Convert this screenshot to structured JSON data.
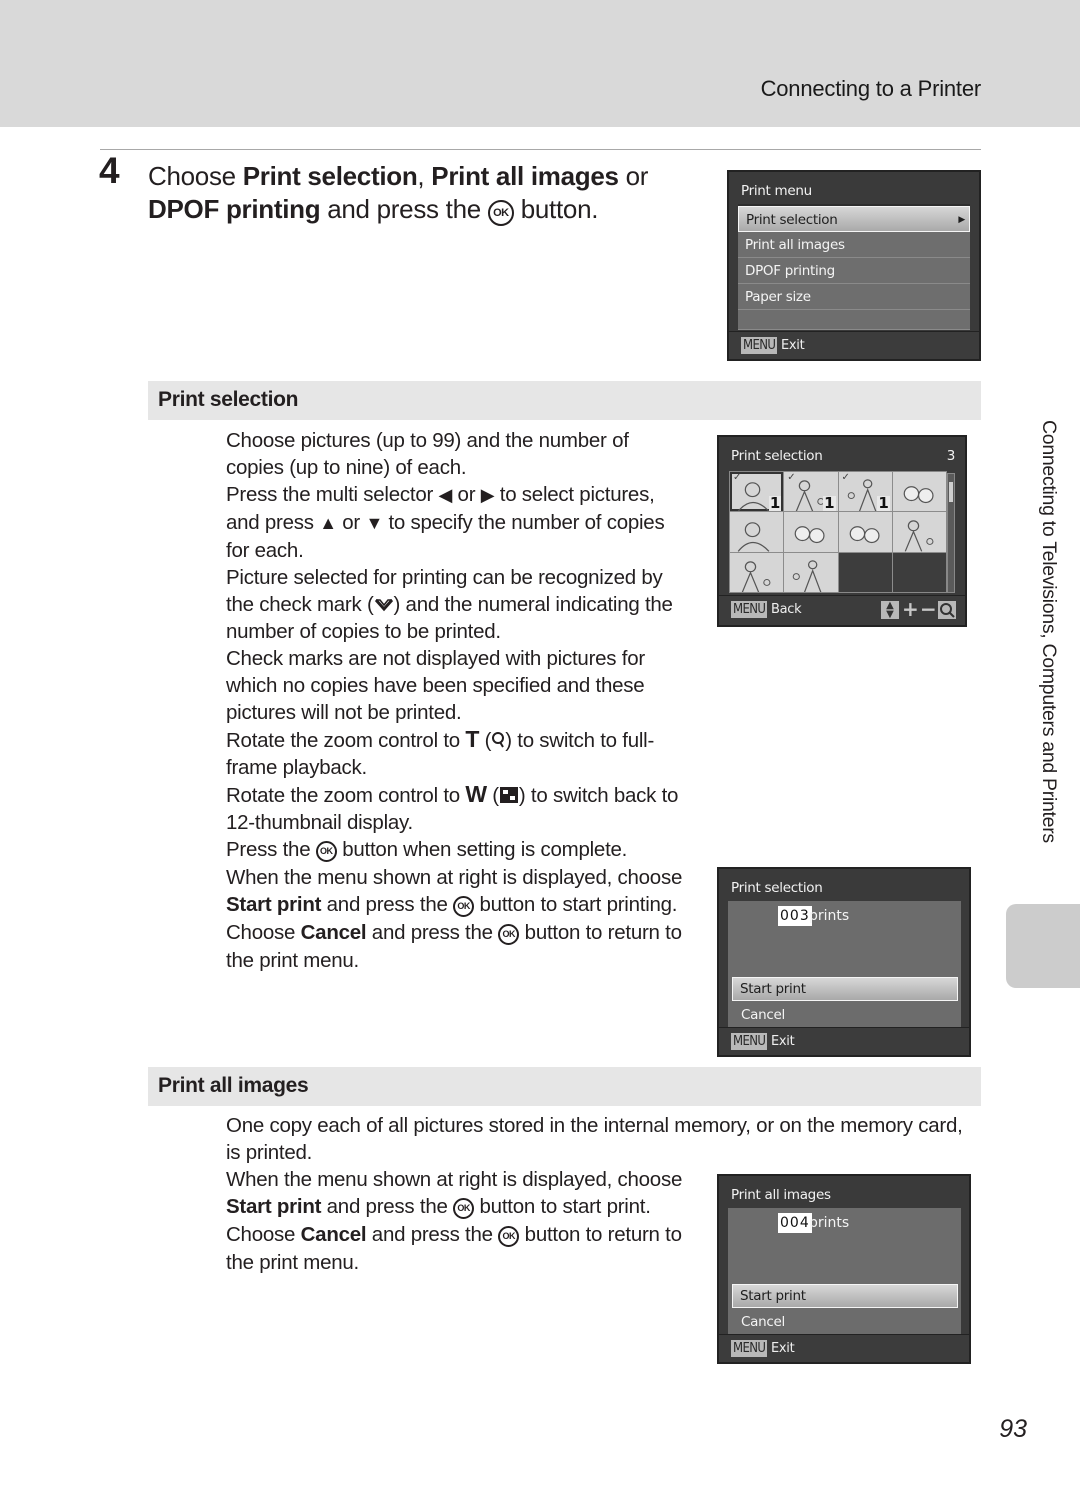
{
  "header": {
    "section_title": "Connecting to a Printer"
  },
  "step": {
    "number": "4",
    "text_parts": {
      "choose": "Choose ",
      "opt1": "Print selection",
      "sep1": ", ",
      "opt2": "Print all images",
      "sep2": " or",
      "opt3": "DPOF printing",
      "tail": " and press the ",
      "ok": "OK",
      "end": " button."
    }
  },
  "print_menu_screen": {
    "title": "Print menu",
    "items": [
      {
        "label": "Print selection",
        "selected": true
      },
      {
        "label": "Print all images",
        "selected": false
      },
      {
        "label": "DPOF printing",
        "selected": false
      },
      {
        "label": "Paper size",
        "selected": false
      }
    ],
    "footer_badge": "MENU",
    "footer_label": "Exit"
  },
  "print_selection": {
    "heading": "Print selection",
    "para1": "Choose pictures (up to 99) and the number of copies (up to nine) of each.",
    "para2_a": "Press the multi selector ",
    "left_arrow": "◀",
    "para2_or1": " or ",
    "right_arrow": "▶",
    "para2_b": " to select pictures, and press ",
    "up_arrow": "▲",
    "para2_or2": " or ",
    "down_arrow": "▼",
    "para2_c": " to specify the number of copies for each.",
    "para3_a": "Picture selected for printing can be recognized by the check mark (",
    "para3_b": ") and the numeral indicating the number of copies to be printed.",
    "para4": "Check marks are not displayed with pictures for which no copies have been specified and these pictures will not be printed.",
    "para5_a": "Rotate the zoom control to ",
    "para5_t": "T",
    "para5_b": " (",
    "para5_c": ") to switch to full-frame playback.",
    "para6_a": "Rotate the zoom control to ",
    "para6_w": "W",
    "para6_b": " (",
    "para6_c": ") to switch back to 12-thumbnail display.",
    "para7_a": "Press the ",
    "para7_b": " button when setting is complete.",
    "para8_a": "When the menu shown at right is displayed, choose ",
    "para8_bold": "Start print",
    "para8_b": " and press the ",
    "para8_c": " button to start printing.",
    "para9_a": "Choose ",
    "para9_bold": "Cancel",
    "para9_b": " and press the ",
    "para9_c": " button to return to the print menu.",
    "ok": "OK",
    "thumb_screen": {
      "title": "Print selection",
      "count": "3",
      "thumbnails": [
        {
          "checked": true,
          "copies": "1",
          "current": true
        },
        {
          "checked": true,
          "copies": "1",
          "current": false
        },
        {
          "checked": true,
          "copies": "1",
          "current": false
        },
        {
          "checked": false,
          "copies": "",
          "current": false
        },
        {
          "checked": false,
          "copies": "",
          "current": false
        },
        {
          "checked": false,
          "copies": "",
          "current": false
        },
        {
          "checked": false,
          "copies": "",
          "current": false
        },
        {
          "checked": false,
          "copies": "",
          "current": false
        },
        {
          "checked": false,
          "copies": "",
          "current": false
        },
        {
          "checked": false,
          "copies": "",
          "current": false
        },
        {
          "empty": true
        },
        {
          "empty": true
        }
      ],
      "footer_badge": "MENU",
      "footer_label": "Back",
      "footer_icons": [
        "up-down-icon",
        "plus-icon",
        "minus-icon",
        "zoom-icon"
      ],
      "check_glyph": "✓",
      "plus": "+",
      "minus": "−"
    },
    "confirm_screen": {
      "title": "Print selection",
      "count": "003",
      "count_label": "prints",
      "options": [
        "Start print",
        "Cancel"
      ],
      "selected_option": "Start print",
      "footer_badge": "MENU",
      "footer_label": "Exit"
    }
  },
  "print_all_images": {
    "heading": "Print all images",
    "para1": "One copy each of all pictures stored in the internal memory, or on the memory card, is printed.",
    "para2_a": "When the menu shown at right is displayed, choose ",
    "para2_bold": "Start print",
    "para2_b": " and press the ",
    "para2_c": " button to start print.",
    "para3_a": "Choose ",
    "para3_bold": "Cancel",
    "para3_b": " and press the ",
    "para3_c": " button to return to the print menu.",
    "ok": "OK",
    "confirm_screen": {
      "title": "Print all images",
      "count": "004",
      "count_label": "prints",
      "options": [
        "Start print",
        "Cancel"
      ],
      "selected_option": "Start print",
      "footer_badge": "MENU",
      "footer_label": "Exit"
    }
  },
  "side_tab": {
    "label": "Connecting to Televisions, Computers and Printers"
  },
  "page_number": "93"
}
